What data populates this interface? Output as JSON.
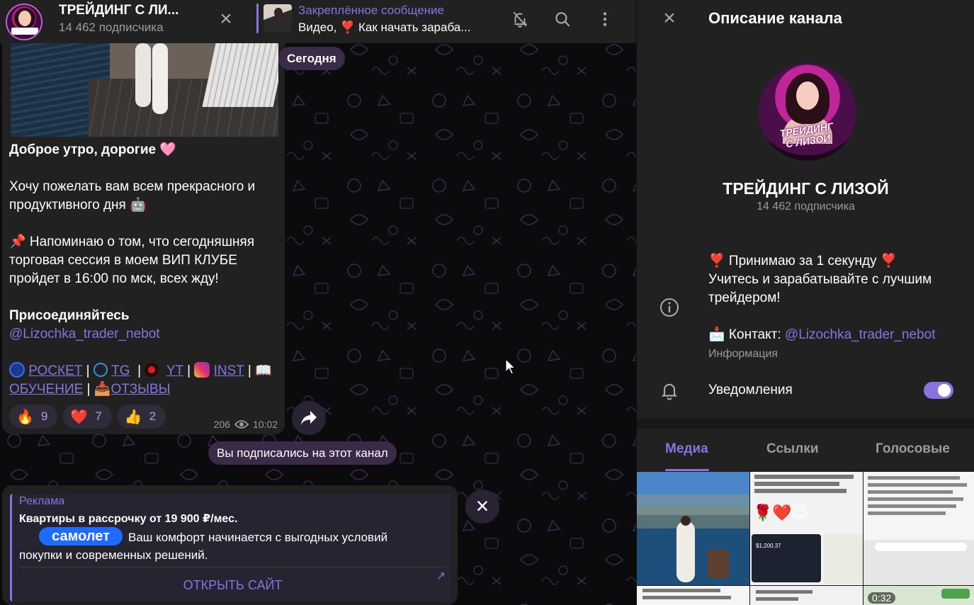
{
  "channel": {
    "title": "ТРЕЙДИНГ С ЛИ...",
    "subscribers": "14 462 подписчика"
  },
  "pinned": {
    "label": "Закреплённое сообщение",
    "text": "Видео, ❣️ Как начать зараба..."
  },
  "icons": {
    "close": "close-icon",
    "mute": "bell-off-icon",
    "search": "search-icon",
    "more": "more-vertical-icon",
    "share": "forward-icon",
    "info": "info-icon",
    "bell": "bell-icon"
  },
  "chat": {
    "date_pill": "Сегодня",
    "service_message": "Вы подписались на этот канал",
    "message": {
      "greeting": "Доброе утро, дорогие 🩷",
      "wish_line1": "Хочу пожелать вам всем прекрасного и",
      "wish_line2": "продуктивного дня 🤖",
      "remind_line1": "📌 Напоминаю о том, что сегодняшняя",
      "remind_line2": "торговая сессия в моем ВИП КЛУБЕ",
      "remind_line3": "пройдет в 16:00 по мск, всех жду!",
      "join": "Присоединяйтесь",
      "mention": "@Lizochka_trader_nebot",
      "links": {
        "pocket": "РОСКЕТ",
        "tg": "TG",
        "yt": "YT",
        "inst": "INST",
        "learning": "ОБУЧЕНИЕ",
        "reviews": "ОТЗЫВЫ",
        "sep": "|"
      },
      "reactions": [
        {
          "emoji": "🔥",
          "count": "9"
        },
        {
          "emoji": "❤️",
          "count": "7"
        },
        {
          "emoji": "👍",
          "count": "2"
        }
      ],
      "views": "206",
      "time": "10:02"
    }
  },
  "ad": {
    "label": "Реклама",
    "title": "Квартиры в рассрочку от 19 900 ₽/мес.",
    "logo": "самолет",
    "body": "Ваш комфорт начинается с выгодных условий покупки и современных решений.",
    "button": "ОТКРЫТЬ САЙТ",
    "arrow": "↗"
  },
  "panel": {
    "title": "Описание канала",
    "name": "ТРЕЙДИНГ С ЛИЗОЙ",
    "subscribers": "14 462 подписчика",
    "avatar_text_1": "ТРЕЙДИНГ",
    "avatar_text_2": "С ЛИЗОЙ",
    "desc_line1": "❣️ Принимаю за 1 секунду ❣️",
    "desc_line2": "Учитесь и зарабатывайте с лучшим трейдером!",
    "contact_prefix": "📩 Контакт: ",
    "contact_link": "@Lizochka_trader_nebot",
    "info_label": "Информация",
    "notifications_label": "Уведомления",
    "notifications_on": true,
    "tabs": [
      "Медиа",
      "Ссылки",
      "Голосовые"
    ],
    "active_tab": "Медиа",
    "video_duration": "0:32"
  },
  "colors": {
    "accent": "#8774e1",
    "panel_bg": "#212121",
    "chat_bg": "#0b0b0d"
  }
}
